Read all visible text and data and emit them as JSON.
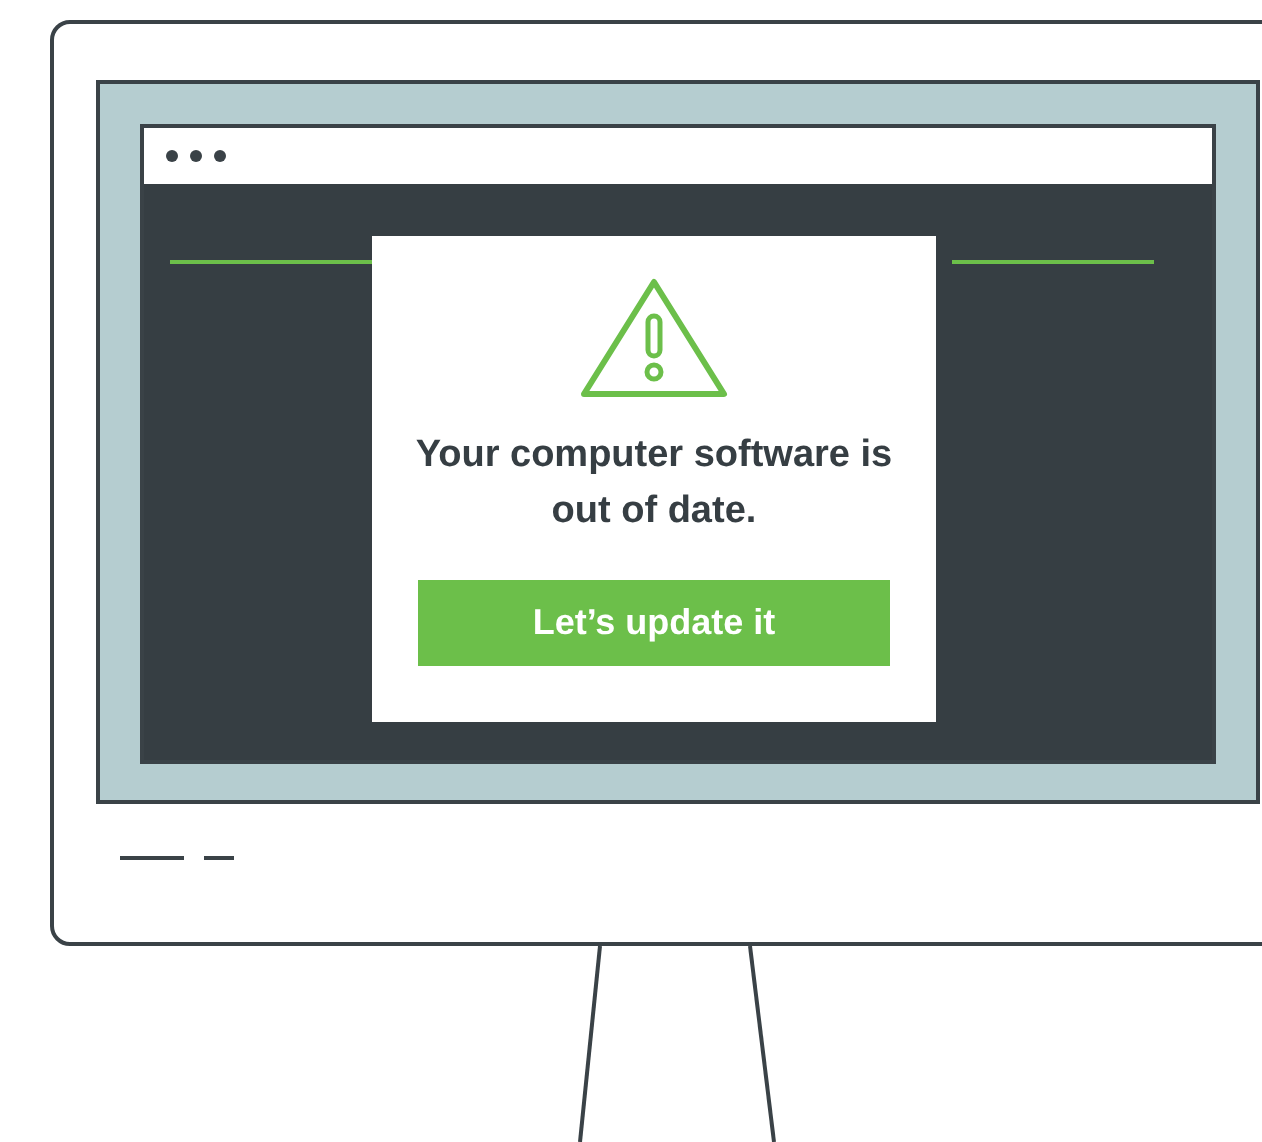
{
  "dialog": {
    "message": "Your computer software is out of date.",
    "button": "Let’s update it"
  }
}
